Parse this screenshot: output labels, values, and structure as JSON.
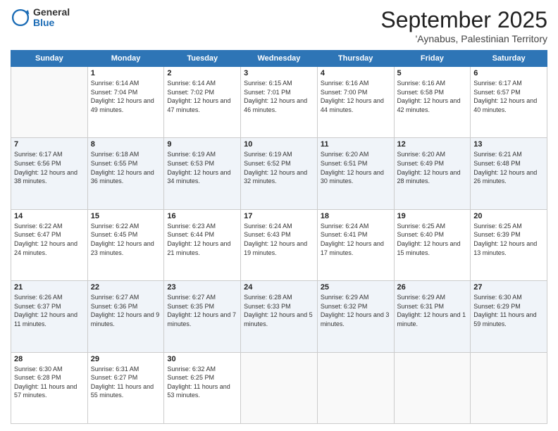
{
  "logo": {
    "general": "General",
    "blue": "Blue"
  },
  "header": {
    "month": "September 2025",
    "location": "'Aynabus, Palestinian Territory"
  },
  "weekdays": [
    "Sunday",
    "Monday",
    "Tuesday",
    "Wednesday",
    "Thursday",
    "Friday",
    "Saturday"
  ],
  "weeks": [
    [
      {
        "day": "",
        "sunrise": "",
        "sunset": "",
        "daylight": ""
      },
      {
        "day": "1",
        "sunrise": "6:14 AM",
        "sunset": "7:04 PM",
        "daylight": "12 hours and 49 minutes."
      },
      {
        "day": "2",
        "sunrise": "6:14 AM",
        "sunset": "7:02 PM",
        "daylight": "12 hours and 47 minutes."
      },
      {
        "day": "3",
        "sunrise": "6:15 AM",
        "sunset": "7:01 PM",
        "daylight": "12 hours and 46 minutes."
      },
      {
        "day": "4",
        "sunrise": "6:16 AM",
        "sunset": "7:00 PM",
        "daylight": "12 hours and 44 minutes."
      },
      {
        "day": "5",
        "sunrise": "6:16 AM",
        "sunset": "6:58 PM",
        "daylight": "12 hours and 42 minutes."
      },
      {
        "day": "6",
        "sunrise": "6:17 AM",
        "sunset": "6:57 PM",
        "daylight": "12 hours and 40 minutes."
      }
    ],
    [
      {
        "day": "7",
        "sunrise": "6:17 AM",
        "sunset": "6:56 PM",
        "daylight": "12 hours and 38 minutes."
      },
      {
        "day": "8",
        "sunrise": "6:18 AM",
        "sunset": "6:55 PM",
        "daylight": "12 hours and 36 minutes."
      },
      {
        "day": "9",
        "sunrise": "6:19 AM",
        "sunset": "6:53 PM",
        "daylight": "12 hours and 34 minutes."
      },
      {
        "day": "10",
        "sunrise": "6:19 AM",
        "sunset": "6:52 PM",
        "daylight": "12 hours and 32 minutes."
      },
      {
        "day": "11",
        "sunrise": "6:20 AM",
        "sunset": "6:51 PM",
        "daylight": "12 hours and 30 minutes."
      },
      {
        "day": "12",
        "sunrise": "6:20 AM",
        "sunset": "6:49 PM",
        "daylight": "12 hours and 28 minutes."
      },
      {
        "day": "13",
        "sunrise": "6:21 AM",
        "sunset": "6:48 PM",
        "daylight": "12 hours and 26 minutes."
      }
    ],
    [
      {
        "day": "14",
        "sunrise": "6:22 AM",
        "sunset": "6:47 PM",
        "daylight": "12 hours and 24 minutes."
      },
      {
        "day": "15",
        "sunrise": "6:22 AM",
        "sunset": "6:45 PM",
        "daylight": "12 hours and 23 minutes."
      },
      {
        "day": "16",
        "sunrise": "6:23 AM",
        "sunset": "6:44 PM",
        "daylight": "12 hours and 21 minutes."
      },
      {
        "day": "17",
        "sunrise": "6:24 AM",
        "sunset": "6:43 PM",
        "daylight": "12 hours and 19 minutes."
      },
      {
        "day": "18",
        "sunrise": "6:24 AM",
        "sunset": "6:41 PM",
        "daylight": "12 hours and 17 minutes."
      },
      {
        "day": "19",
        "sunrise": "6:25 AM",
        "sunset": "6:40 PM",
        "daylight": "12 hours and 15 minutes."
      },
      {
        "day": "20",
        "sunrise": "6:25 AM",
        "sunset": "6:39 PM",
        "daylight": "12 hours and 13 minutes."
      }
    ],
    [
      {
        "day": "21",
        "sunrise": "6:26 AM",
        "sunset": "6:37 PM",
        "daylight": "12 hours and 11 minutes."
      },
      {
        "day": "22",
        "sunrise": "6:27 AM",
        "sunset": "6:36 PM",
        "daylight": "12 hours and 9 minutes."
      },
      {
        "day": "23",
        "sunrise": "6:27 AM",
        "sunset": "6:35 PM",
        "daylight": "12 hours and 7 minutes."
      },
      {
        "day": "24",
        "sunrise": "6:28 AM",
        "sunset": "6:33 PM",
        "daylight": "12 hours and 5 minutes."
      },
      {
        "day": "25",
        "sunrise": "6:29 AM",
        "sunset": "6:32 PM",
        "daylight": "12 hours and 3 minutes."
      },
      {
        "day": "26",
        "sunrise": "6:29 AM",
        "sunset": "6:31 PM",
        "daylight": "12 hours and 1 minute."
      },
      {
        "day": "27",
        "sunrise": "6:30 AM",
        "sunset": "6:29 PM",
        "daylight": "11 hours and 59 minutes."
      }
    ],
    [
      {
        "day": "28",
        "sunrise": "6:30 AM",
        "sunset": "6:28 PM",
        "daylight": "11 hours and 57 minutes."
      },
      {
        "day": "29",
        "sunrise": "6:31 AM",
        "sunset": "6:27 PM",
        "daylight": "11 hours and 55 minutes."
      },
      {
        "day": "30",
        "sunrise": "6:32 AM",
        "sunset": "6:25 PM",
        "daylight": "11 hours and 53 minutes."
      },
      {
        "day": "",
        "sunrise": "",
        "sunset": "",
        "daylight": ""
      },
      {
        "day": "",
        "sunrise": "",
        "sunset": "",
        "daylight": ""
      },
      {
        "day": "",
        "sunrise": "",
        "sunset": "",
        "daylight": ""
      },
      {
        "day": "",
        "sunrise": "",
        "sunset": "",
        "daylight": ""
      }
    ]
  ]
}
